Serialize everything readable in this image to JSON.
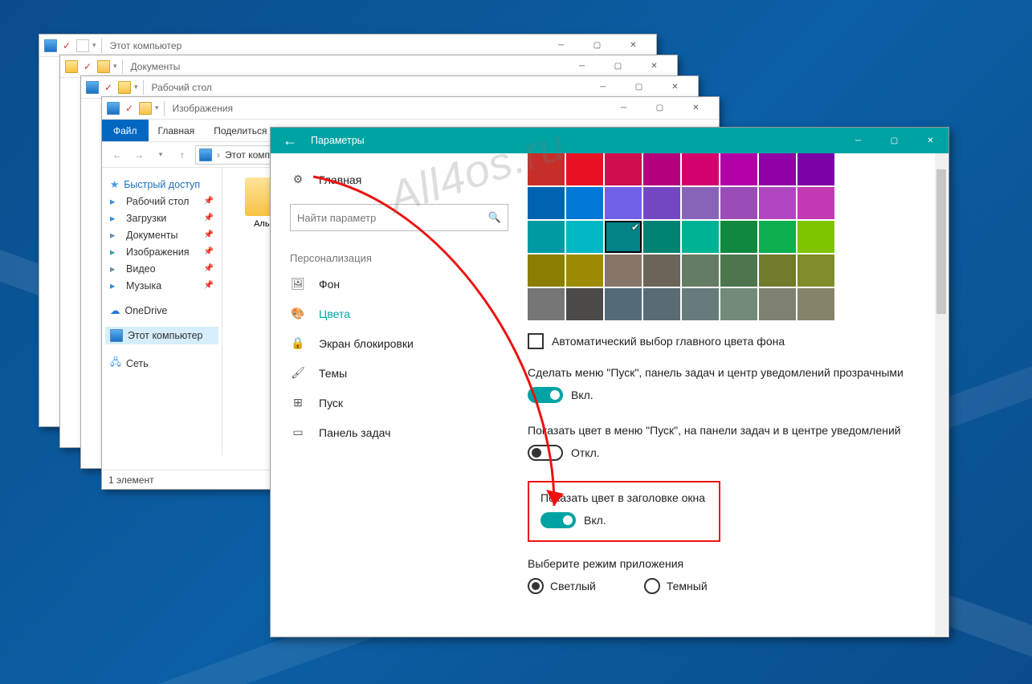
{
  "watermark": "All4os.ru",
  "explorer_stack": [
    {
      "title": "Этот компьютер",
      "icon": "pc"
    },
    {
      "title": "Документы",
      "icon": "folder"
    },
    {
      "title": "Рабочий стол",
      "icon": "folder"
    },
    {
      "title": "Изображения",
      "icon": "folder"
    }
  ],
  "explorer_top": {
    "title": "Изображения",
    "ribbon": {
      "file": "Файл",
      "tabs": [
        "Главная",
        "Поделиться"
      ]
    },
    "address_caption": "Этот компь",
    "sidebar": {
      "quick_access": "Быстрый доступ",
      "items": [
        {
          "label": "Рабочий стол",
          "icon": "desktop-icon",
          "color": "#2f8fe0"
        },
        {
          "label": "Загрузки",
          "icon": "downloads-icon",
          "color": "#2f8fe0"
        },
        {
          "label": "Документы",
          "icon": "documents-icon",
          "color": "#6a8aa8"
        },
        {
          "label": "Изображения",
          "icon": "pictures-icon",
          "color": "#39a0a0"
        },
        {
          "label": "Видео",
          "icon": "videos-icon",
          "color": "#6a8aa8"
        },
        {
          "label": "Музыка",
          "icon": "music-icon",
          "color": "#2f8fe0"
        }
      ],
      "onedrive": "OneDrive",
      "this_pc": "Этот компьютер",
      "network": "Сеть"
    },
    "content_item": "Альб",
    "status": "1 элемент"
  },
  "settings": {
    "title": "Параметры",
    "nav": {
      "home": "Главная",
      "search_placeholder": "Найти параметр",
      "category": "Персонализация",
      "items": [
        "Фон",
        "Цвета",
        "Экран блокировки",
        "Темы",
        "Пуск",
        "Панель задач"
      ],
      "active_index": 1
    },
    "palette": [
      [
        "#c62f29",
        "#e81123",
        "#ce0e4e",
        "#b4007c",
        "#d4006d",
        "#b200a6",
        "#8f00a6",
        "#7a00a6"
      ],
      [
        "#0063b1",
        "#0078d7",
        "#7160e8",
        "#7447c2",
        "#8764b8",
        "#9a4db6",
        "#b146c2",
        "#c239b3"
      ],
      [
        "#009aa3",
        "#00b7c3",
        "#038387",
        "#008272",
        "#00b294",
        "#10893e",
        "#0cae50",
        "#7ec500"
      ],
      [
        "#8a7d00",
        "#9c8b00",
        "#877567",
        "#6b6458",
        "#647c64",
        "#4c754c",
        "#6f7a2a",
        "#7e8c2a"
      ],
      [
        "#767676",
        "#4c4a48",
        "#546a79",
        "#576c73",
        "#667b7b",
        "#738a78",
        "#7f8170",
        "#858469"
      ]
    ],
    "palette_selected_row": 2,
    "palette_selected_col": 2,
    "auto_color": {
      "label": "Автоматический выбор главного цвета фона",
      "checked": false
    },
    "option1": {
      "label": "Сделать меню \"Пуск\", панель задач и центр уведомлений прозрачными",
      "state_label": "Вкл.",
      "on": true
    },
    "option2": {
      "label": "Показать цвет в меню \"Пуск\", на панели задач и в центре уведомлений",
      "state_label": "Откл.",
      "on": false
    },
    "option3": {
      "label": "Показать цвет в заголовке окна",
      "state_label": "Вкл.",
      "on": true
    },
    "app_mode": {
      "label": "Выберите режим приложения",
      "light": "Светлый",
      "dark": "Темный",
      "selected": "light"
    }
  }
}
